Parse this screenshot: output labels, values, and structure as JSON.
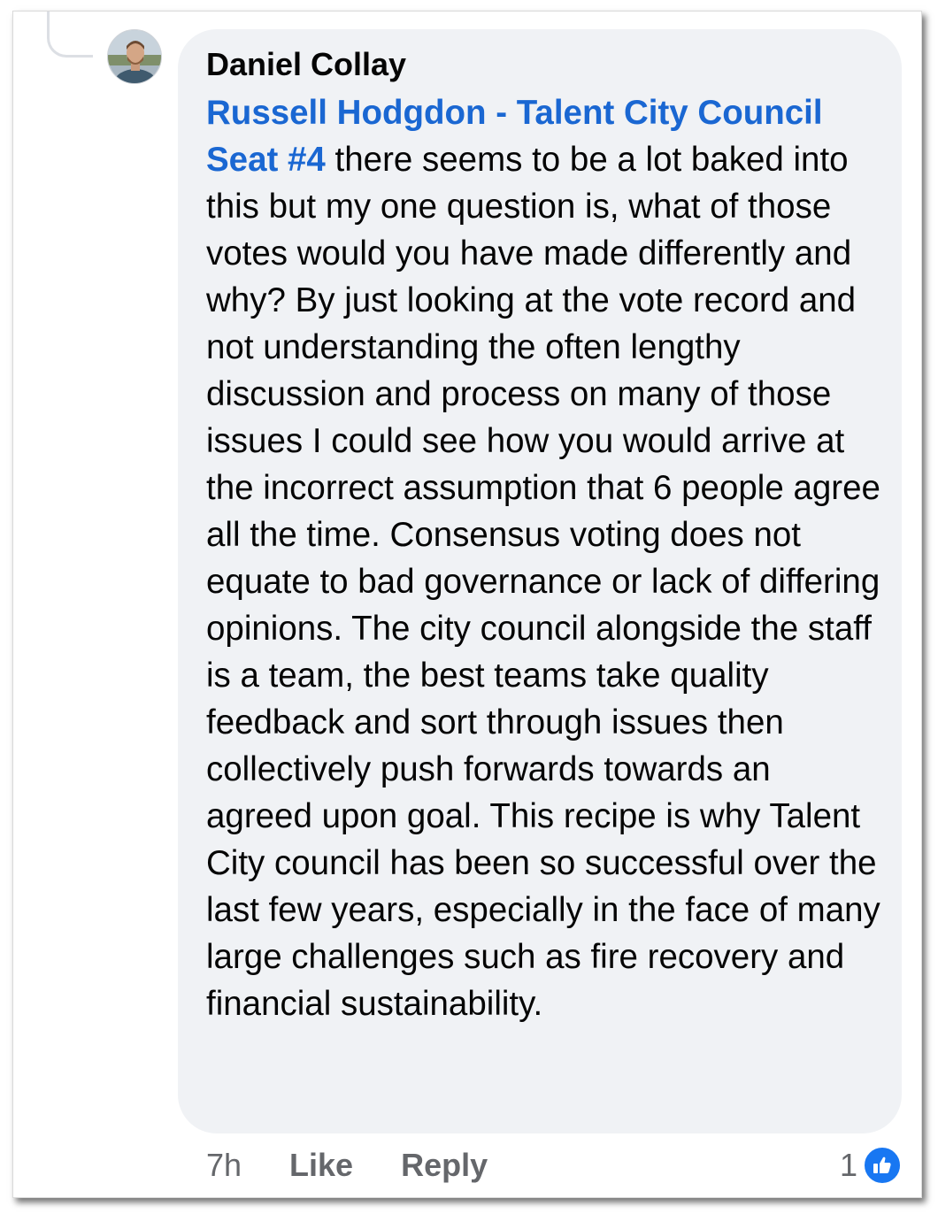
{
  "comment": {
    "author": "Daniel Collay",
    "mention": "Russell Hodgdon - Talent City Council Seat #4",
    "text": " there seems to be a lot baked into this but my one question is, what of those votes would you have made differently and why? By just looking at the vote record and not understanding the often lengthy discussion and process on many of those issues I could see how you would arrive at the incorrect assumption that 6 people agree all the time. Consensus voting does not equate to bad governance or lack of differing opinions. The city council alongside the staff is a team, the best teams take quality feedback and sort through issues then collectively push forwards towards an agreed upon goal. This recipe is why Talent City council has been so successful over the last few years, especially in the face of many large challenges such as fire recovery and financial sustainability."
  },
  "actions": {
    "time": "7h",
    "like": "Like",
    "reply": "Reply"
  },
  "reactions": {
    "count": "1",
    "icon": "thumbs-up-icon"
  },
  "colors": {
    "bubble": "#f0f2f5",
    "mention": "#1a67d2",
    "meta": "#65676b",
    "like_badge": "#1877f2"
  }
}
